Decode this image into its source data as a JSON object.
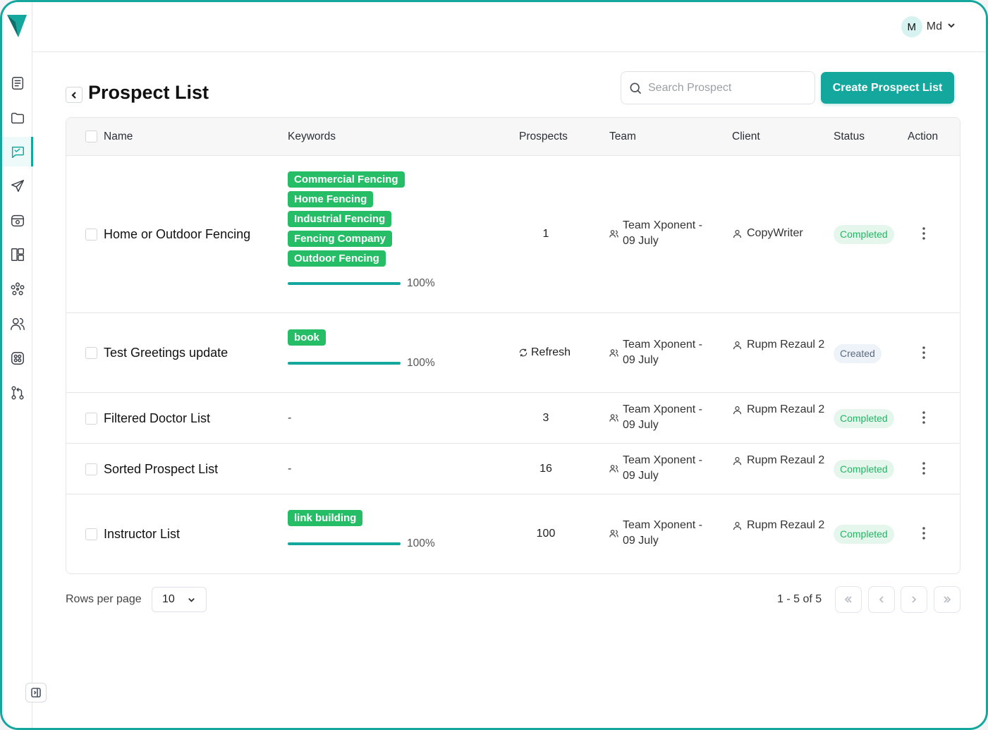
{
  "app": {
    "brand_color": "#14a79d"
  },
  "sidebar": {
    "items": [
      {
        "name": "documents",
        "icon": "document-icon",
        "active": false
      },
      {
        "name": "folders",
        "icon": "folder-icon",
        "active": false
      },
      {
        "name": "prospects",
        "icon": "chat-list-icon",
        "active": true
      },
      {
        "name": "campaigns",
        "icon": "send-icon",
        "active": false
      },
      {
        "name": "inbox",
        "icon": "inbox-icon",
        "active": false
      },
      {
        "name": "boards",
        "icon": "layout-icon",
        "active": false
      },
      {
        "name": "network",
        "icon": "network-icon",
        "active": false
      },
      {
        "name": "users",
        "icon": "users-icon",
        "active": false
      },
      {
        "name": "integrations",
        "icon": "apps-icon",
        "active": false
      },
      {
        "name": "workflows",
        "icon": "git-icon",
        "active": false
      }
    ]
  },
  "topbar": {
    "avatar_initial": "M",
    "user_name": "Md"
  },
  "header": {
    "title": "Prospect List",
    "search_placeholder": "Search Prospect",
    "create_label": "Create Prospect List"
  },
  "table": {
    "columns": [
      "Name",
      "Keywords",
      "Prospects",
      "Team",
      "Client",
      "Status",
      "Action"
    ],
    "rows": [
      {
        "name": "Home or Outdoor Fencing",
        "keywords": [
          "Commercial Fencing",
          "Home Fencing",
          "Industrial Fencing",
          "Fencing Company",
          "Outdoor Fencing"
        ],
        "progress_label": "100%",
        "progress": 1.0,
        "prospects": "1",
        "team": "Team Xponent - 09 July",
        "client": "CopyWriter",
        "status": "Completed"
      },
      {
        "name": "Test Greetings update",
        "keywords": [
          "book"
        ],
        "progress_label": "100%",
        "progress": 1.0,
        "prospects": "Refresh",
        "team": "Team Xponent - 09 July",
        "client": "Rupm Rezaul 2",
        "status": "Created"
      },
      {
        "name": "Filtered Doctor List",
        "keywords_empty": "-",
        "prospects": "3",
        "team": "Team Xponent - 09 July",
        "client": "Rupm Rezaul 2",
        "status": "Completed"
      },
      {
        "name": "Sorted Prospect List",
        "keywords_empty": "-",
        "prospects": "16",
        "team": "Team Xponent - 09 July",
        "client": "Rupm Rezaul 2",
        "status": "Completed"
      },
      {
        "name": "Instructor List",
        "keywords": [
          "link building"
        ],
        "progress_label": "100%",
        "progress": 1.0,
        "prospects": "100",
        "team": "Team Xponent - 09 July",
        "client": "Rupm Rezaul 2",
        "status": "Completed"
      }
    ]
  },
  "pagination": {
    "rows_label": "Rows per page",
    "rows_value": "10",
    "info": "1 - 5 of 5"
  }
}
